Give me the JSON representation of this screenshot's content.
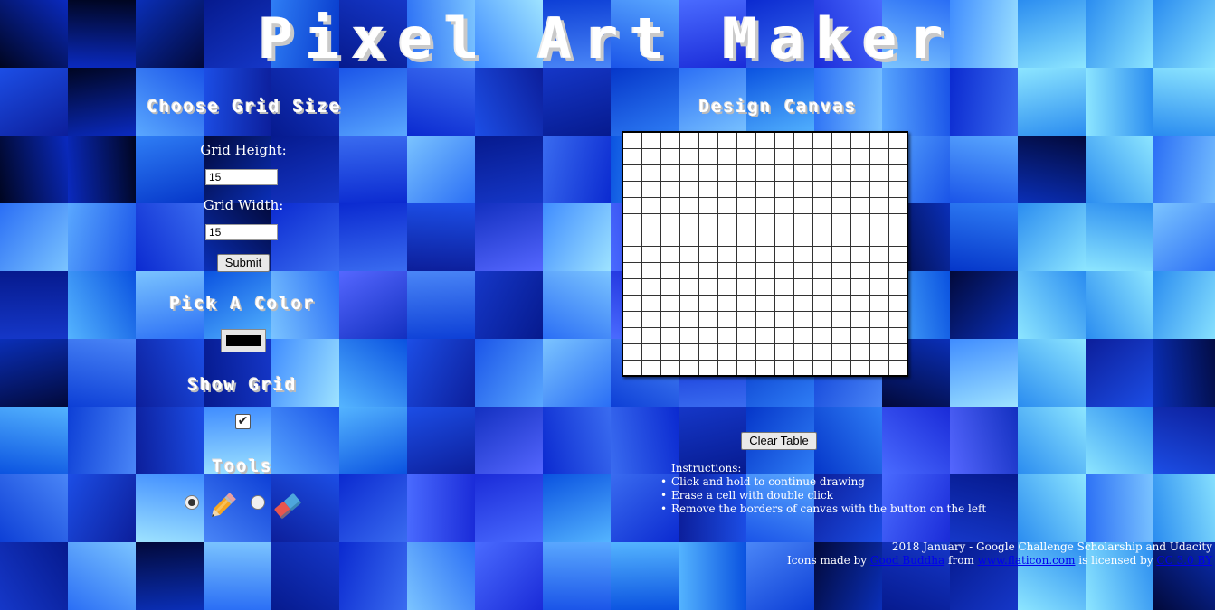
{
  "title": "Pixel Art Maker",
  "grid_section": {
    "heading": "Choose Grid Size",
    "height_label": "Grid Height:",
    "height_value": "15",
    "width_label": "Grid Width:",
    "width_value": "15",
    "submit_label": "Submit"
  },
  "color_section": {
    "heading": "Pick A Color",
    "selected_color": "#000000"
  },
  "show_grid_section": {
    "heading": "Show Grid",
    "checked": true,
    "check_glyph": "✔"
  },
  "tools_section": {
    "heading": "Tools",
    "tools": [
      {
        "icon": "pencil-icon",
        "selected": true
      },
      {
        "icon": "eraser-icon",
        "selected": false
      }
    ]
  },
  "canvas_section": {
    "heading": "Design Canvas",
    "rows": 15,
    "cols": 15,
    "clear_label": "Clear Table"
  },
  "instructions": {
    "heading": "Instructions:",
    "items": [
      "Click and hold to continue drawing",
      "Erase a cell with double click",
      "Remove the borders of canvas with the button on the left"
    ]
  },
  "footer": {
    "line1": "2018 January - Google Challenge Scholarship and Udacity",
    "icons_prefix": "Icons made by",
    "author_link": "Good Buddha",
    "from_text": "from",
    "site_link": "www.flaticon.com",
    "licensed_text": "is licensed by",
    "license_link": "CC 3.0 BY"
  },
  "colors": {
    "background_accent": "#1e44d6",
    "canvas_bg": "#ffffff",
    "grid_line": "#333333"
  }
}
